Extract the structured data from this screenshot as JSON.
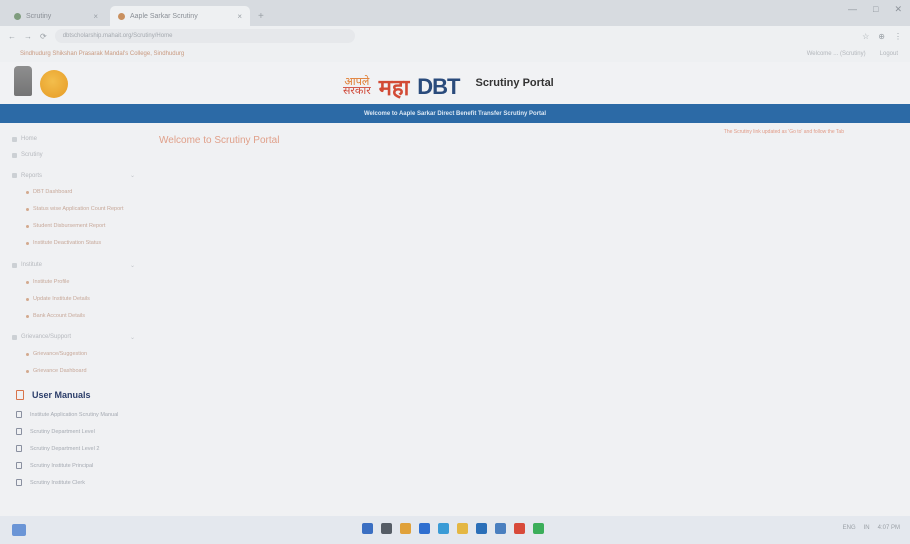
{
  "browser": {
    "tabs": [
      {
        "label": "Scrutiny",
        "active": false
      },
      {
        "label": "Aaple Sarkar Scrutiny",
        "active": true
      }
    ],
    "new_tab": "+",
    "window_controls": {
      "minimize": "—",
      "maximize": "□",
      "close": "✕"
    },
    "nav": {
      "back": "←",
      "forward": "→",
      "reload": "⟳"
    },
    "url": "dbtscholarship.mahait.org/Scrutiny/Home",
    "toolbar_icons": [
      "☆",
      "⊕",
      "⋮"
    ],
    "bookmark": "Sindhudurg Shikshan Prasarak Mandal's College, Sindhudurg",
    "user_info": "Welcome ... (Scrutiny)",
    "logout": "Logout"
  },
  "header": {
    "apale": "आपले",
    "sarkar": "सरकार",
    "maha": "महा",
    "dbt": "DBT",
    "portal_title": "Scrutiny Portal"
  },
  "banner_text": "Welcome to Aaple Sarkar Direct Benefit Transfer Scrutiny Portal",
  "sidebar": {
    "items": [
      {
        "label": "Home"
      },
      {
        "label": "Scrutiny"
      }
    ],
    "reports": {
      "label": "Reports",
      "children": [
        "DBT Dashboard",
        "Status wise Application Count Report",
        "Student Disbursement Report",
        "Institute Deactivation Status"
      ]
    },
    "institute": {
      "label": "Institute",
      "children": [
        "Institute Profile",
        "Update Institute Details",
        "Bank Account Details"
      ]
    },
    "grievance": {
      "label": "Grievance/Support",
      "children": [
        "Grievance/Suggestion",
        "Grievance Dashboard"
      ]
    },
    "manuals_title": "User Manuals",
    "manuals": [
      "Institute Application Scrutiny Manual",
      "Scrutiny Department Level",
      "Scrutiny Department Level 2",
      "Scrutiny Institute Principal",
      "Scrutiny Institute Clerk"
    ]
  },
  "main": {
    "welcome": "Welcome to Scrutiny Portal",
    "note": "The Scrutiny link updated as 'Go to' and follow the Tab"
  },
  "taskbar": {
    "apps": [
      "#3b6fc2",
      "#565d66",
      "#e0a13a",
      "#2f6fd0",
      "#3a9bd6",
      "#e4b743",
      "#2b6fb8",
      "#4a7fbf",
      "#d84a3a",
      "#3cae5a"
    ],
    "lang": "ENG",
    "region": "IN",
    "time": "4:07 PM"
  }
}
